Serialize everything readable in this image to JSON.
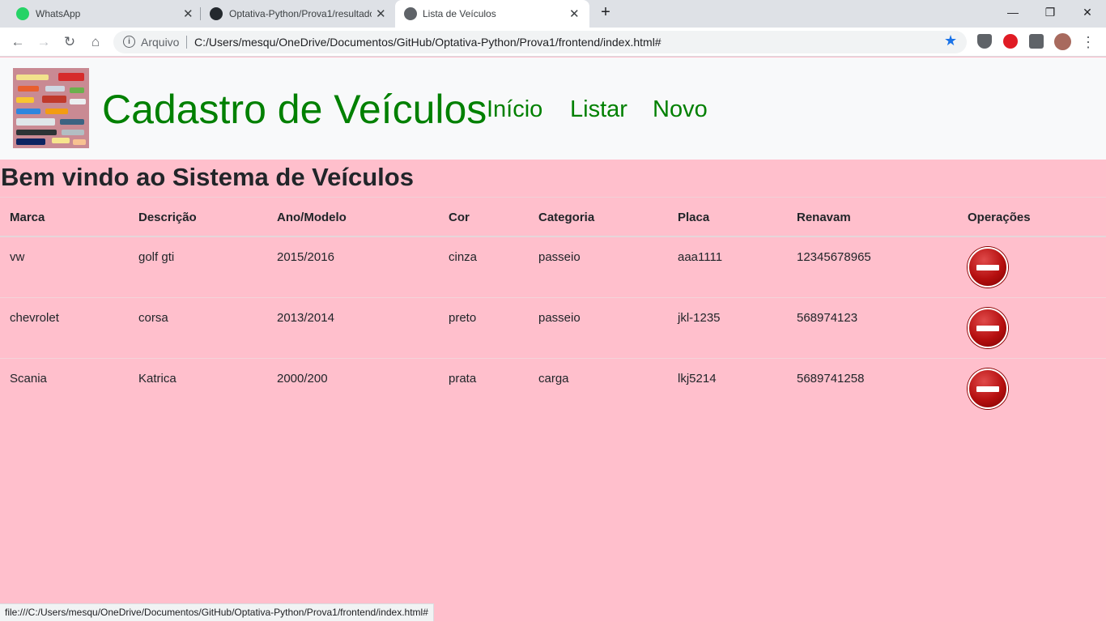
{
  "browser": {
    "tabs": [
      {
        "title": "WhatsApp",
        "icon": "whatsapp-icon",
        "active": false
      },
      {
        "title": "Optativa-Python/Prova1/resultado",
        "icon": "github-icon",
        "active": false
      },
      {
        "title": "Lista de Veículos",
        "icon": "globe-icon",
        "active": true
      }
    ],
    "new_tab": "+",
    "window_controls": {
      "minimize": "—",
      "restore": "❐",
      "close": "✕"
    },
    "address": {
      "security_label": "Arquivo",
      "url": "C:/Users/mesqu/OneDrive/Documentos/GitHub/Optativa-Python/Prova1/frontend/index.html#"
    },
    "extensions": [
      "shield-icon",
      "adblock-icon",
      "puzzle-icon",
      "avatar"
    ],
    "status_url": "file:///C:/Users/mesqu/OneDrive/Documentos/GitHub/Optativa-Python/Prova1/frontend/index.html#"
  },
  "navbar": {
    "brand": "Cadastro de Veículos",
    "links": [
      "Início",
      "Listar",
      "Novo"
    ]
  },
  "welcome": "Bem vindo ao Sistema de Veículos",
  "table": {
    "headers": [
      "Marca",
      "Descrição",
      "Ano/Modelo",
      "Cor",
      "Categoria",
      "Placa",
      "Renavam",
      "Operações"
    ],
    "rows": [
      [
        "vw",
        "golf gti",
        "2015/2016",
        "cinza",
        "passeio",
        "aaa1111",
        "12345678965"
      ],
      [
        "chevrolet",
        "corsa",
        "2013/2014",
        "preto",
        "passeio",
        "jkl-1235",
        "568974123"
      ],
      [
        "Scania",
        "Katrica",
        "2000/200",
        "prata",
        "carga",
        "lkj5214",
        "5689741258"
      ]
    ]
  },
  "colors": {
    "page_background": "#ffbfcc",
    "navbar_background": "#f8f9fa",
    "brand_green": "#008000",
    "delete_red": "#b50f0f"
  }
}
